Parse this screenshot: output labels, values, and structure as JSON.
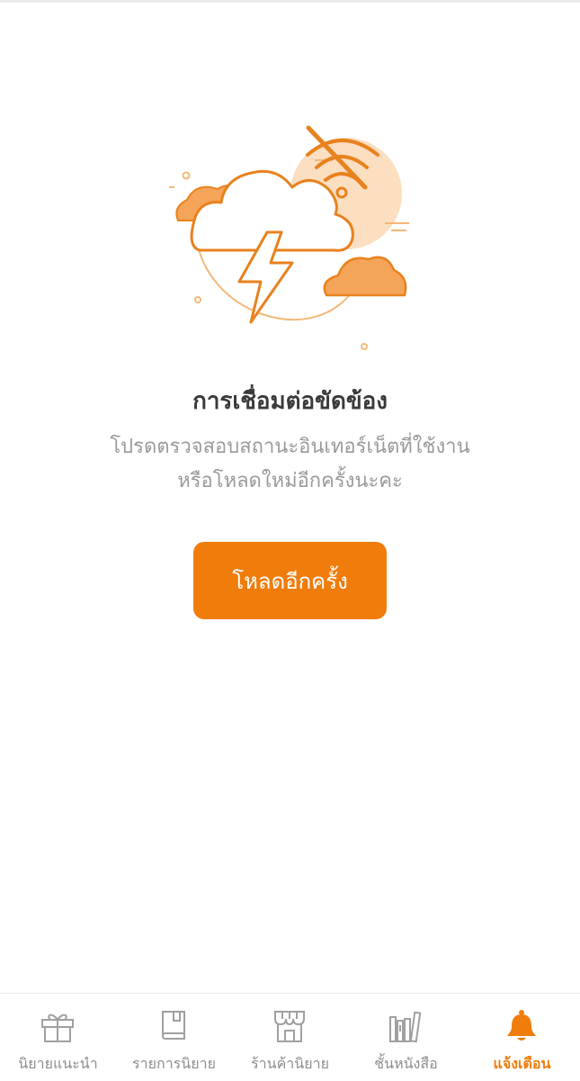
{
  "error": {
    "title": "การเชื่อมต่อขัดข้อง",
    "message_line1": "โปรดตรวจสอบสถานะอินเทอร์เน็ตที่ใช้งาน",
    "message_line2": "หรือโหลดใหม่อีกครั้งนะคะ",
    "illustration": "no-wifi-storm-cloud-icon"
  },
  "reload_button": {
    "label": "โหลดอีกครั้ง"
  },
  "bottom_nav": {
    "items": [
      {
        "label": "นิยายแนะนำ",
        "icon": "gift-icon",
        "active": false
      },
      {
        "label": "รายการนิยาย",
        "icon": "book-icon",
        "active": false
      },
      {
        "label": "ร้านค้านิยาย",
        "icon": "store-icon",
        "active": false
      },
      {
        "label": "ชั้นหนังสือ",
        "icon": "bookshelf-icon",
        "active": false
      },
      {
        "label": "แจ้งเตือน",
        "icon": "bell-icon",
        "active": true
      }
    ]
  },
  "colors": {
    "accent": "#f07c0c",
    "accent_light": "#fbd3ac",
    "text_dark": "#3a3a3a",
    "text_muted": "#9a9a9a",
    "nav_inactive": "#8d8d8d"
  }
}
